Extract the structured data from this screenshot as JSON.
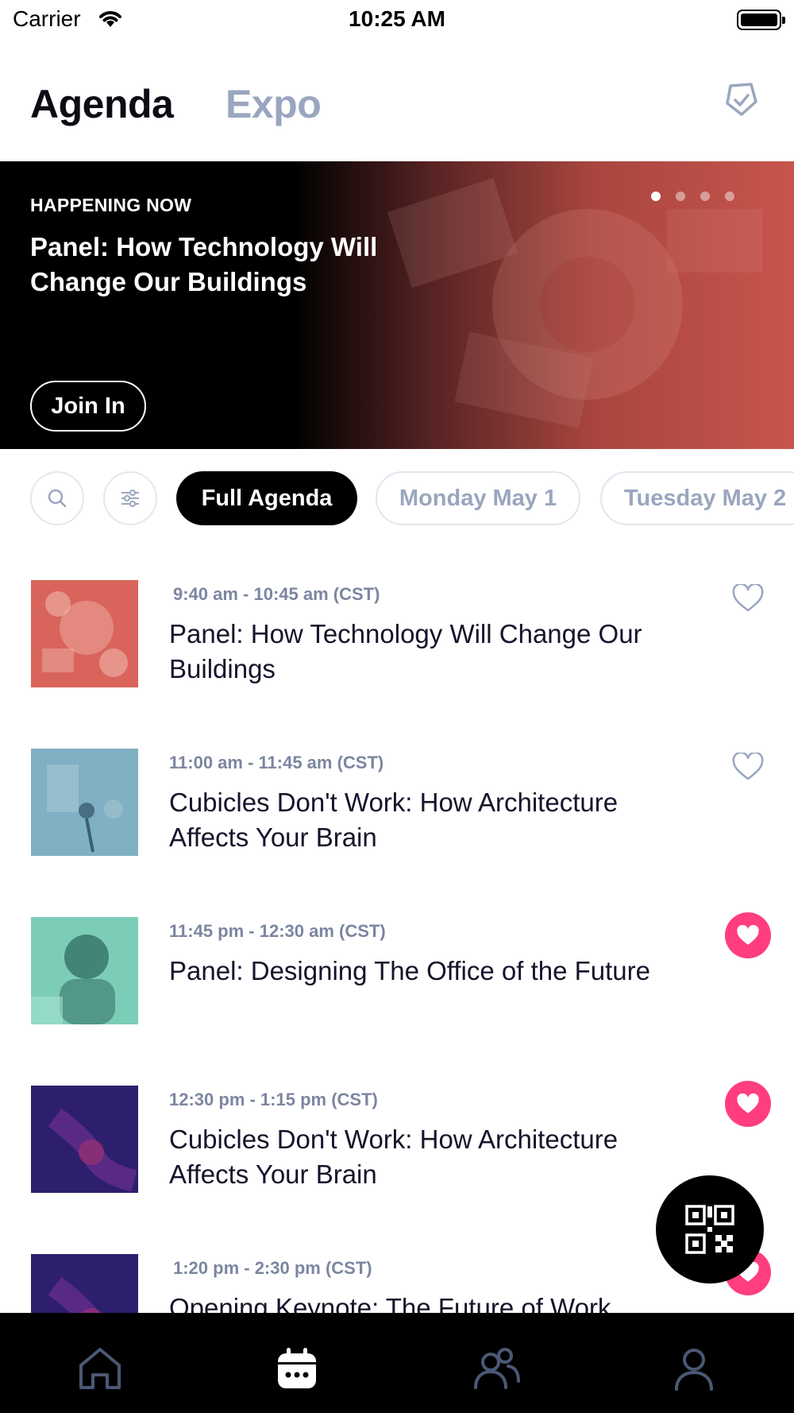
{
  "status_bar": {
    "carrier": "Carrier",
    "time": "10:25 AM"
  },
  "header": {
    "tabs": [
      {
        "label": "Agenda",
        "active": true
      },
      {
        "label": "Expo",
        "active": false
      }
    ],
    "icon": "badge-shield-icon"
  },
  "hero": {
    "label": "HAPPENING NOW",
    "title": "Panel: How Technology Will Change Our Buildings",
    "join_label": "Join In",
    "slide_count": 4,
    "active_slide": 1
  },
  "filters": {
    "search_icon": "search-icon",
    "filter_icon": "sliders-icon",
    "pills": [
      {
        "label": "Full Agenda",
        "active": true
      },
      {
        "label": "Monday May 1",
        "active": false
      },
      {
        "label": "Tuesday May 2",
        "active": false
      }
    ]
  },
  "agenda": [
    {
      "time": "9:40 am - 10:45 am (CST)",
      "title": "Panel: How Technology Will Change Our Buildings",
      "favorited": false,
      "thumb_color": "#d8645b"
    },
    {
      "time": "11:00 am - 11:45 am (CST)",
      "title": "Cubicles Don't Work: How Architecture Affects Your Brain",
      "favorited": false,
      "thumb_color": "#7fb0c4"
    },
    {
      "time": "11:45 pm - 12:30 am (CST)",
      "title": "Panel: Designing The Office of the Future",
      "favorited": true,
      "thumb_color": "#7ccdb8"
    },
    {
      "time": "12:30 pm -  1:15 pm (CST)",
      "title": "Cubicles Don't Work: How Architecture Affects Your Brain",
      "favorited": true,
      "thumb_color": "#2d1f6e"
    },
    {
      "time": "1:20 pm -  2:30 pm (CST)",
      "title": "Opening Keynote: The Future of Work",
      "favorited": true,
      "thumb_color": "#2d1f6e"
    }
  ],
  "colors": {
    "accent": "#ff3d7f",
    "muted": "#9aa6bf",
    "nav_active": "#ffffff",
    "nav_inactive": "#4b5875"
  },
  "bottom_nav": [
    {
      "icon": "home-icon",
      "active": false
    },
    {
      "icon": "calendar-icon",
      "active": true
    },
    {
      "icon": "people-icon",
      "active": false
    },
    {
      "icon": "profile-icon",
      "active": false
    }
  ],
  "fab": {
    "icon": "qr-code-icon"
  }
}
